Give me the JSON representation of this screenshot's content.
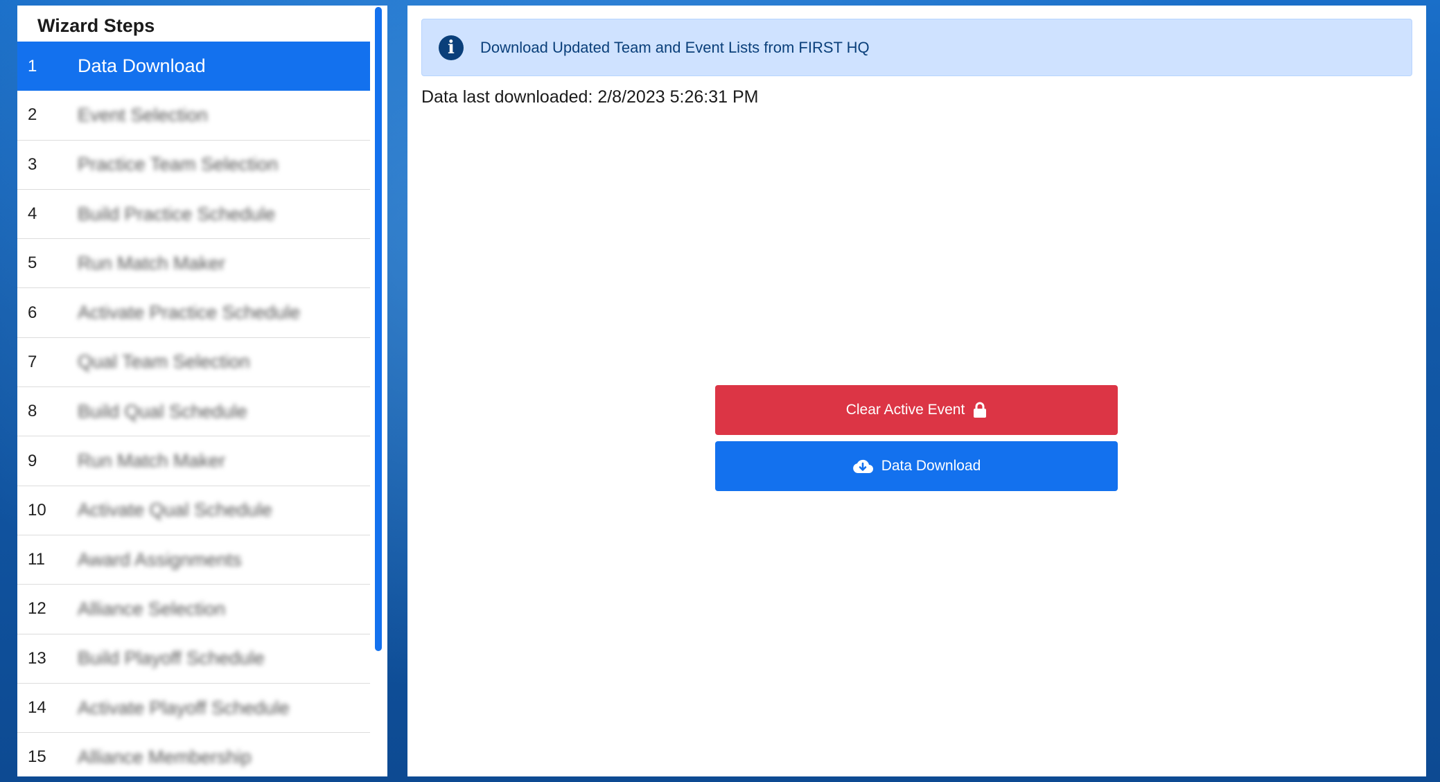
{
  "sidebar": {
    "title": "Wizard Steps",
    "steps": [
      {
        "num": "1",
        "label": "Data Download",
        "active": true
      },
      {
        "num": "2",
        "label": "Event Selection"
      },
      {
        "num": "3",
        "label": "Practice Team Selection"
      },
      {
        "num": "4",
        "label": "Build Practice Schedule"
      },
      {
        "num": "5",
        "label": "Run Match Maker"
      },
      {
        "num": "6",
        "label": "Activate Practice Schedule"
      },
      {
        "num": "7",
        "label": "Qual Team Selection"
      },
      {
        "num": "8",
        "label": "Build Qual Schedule"
      },
      {
        "num": "9",
        "label": "Run Match Maker"
      },
      {
        "num": "10",
        "label": "Activate Qual Schedule"
      },
      {
        "num": "11",
        "label": "Award Assignments"
      },
      {
        "num": "12",
        "label": "Alliance Selection"
      },
      {
        "num": "13",
        "label": "Build Playoff Schedule"
      },
      {
        "num": "14",
        "label": "Activate Playoff Schedule"
      },
      {
        "num": "15",
        "label": "Alliance Membership"
      }
    ]
  },
  "main": {
    "info_message": "Download Updated Team and Event Lists from FIRST HQ",
    "info_icon": "info-circle-icon",
    "last_downloaded": "Data last downloaded: 2/8/2023 5:26:31 PM",
    "clear_button_label": "Clear Active Event",
    "clear_button_icon": "lock-icon",
    "download_button_label": "Data Download",
    "download_button_icon": "cloud-download-icon"
  },
  "colors": {
    "accent": "#1371ee",
    "danger": "#dc3545",
    "info_bg": "#cfe2ff",
    "info_text": "#0a3f7a"
  }
}
